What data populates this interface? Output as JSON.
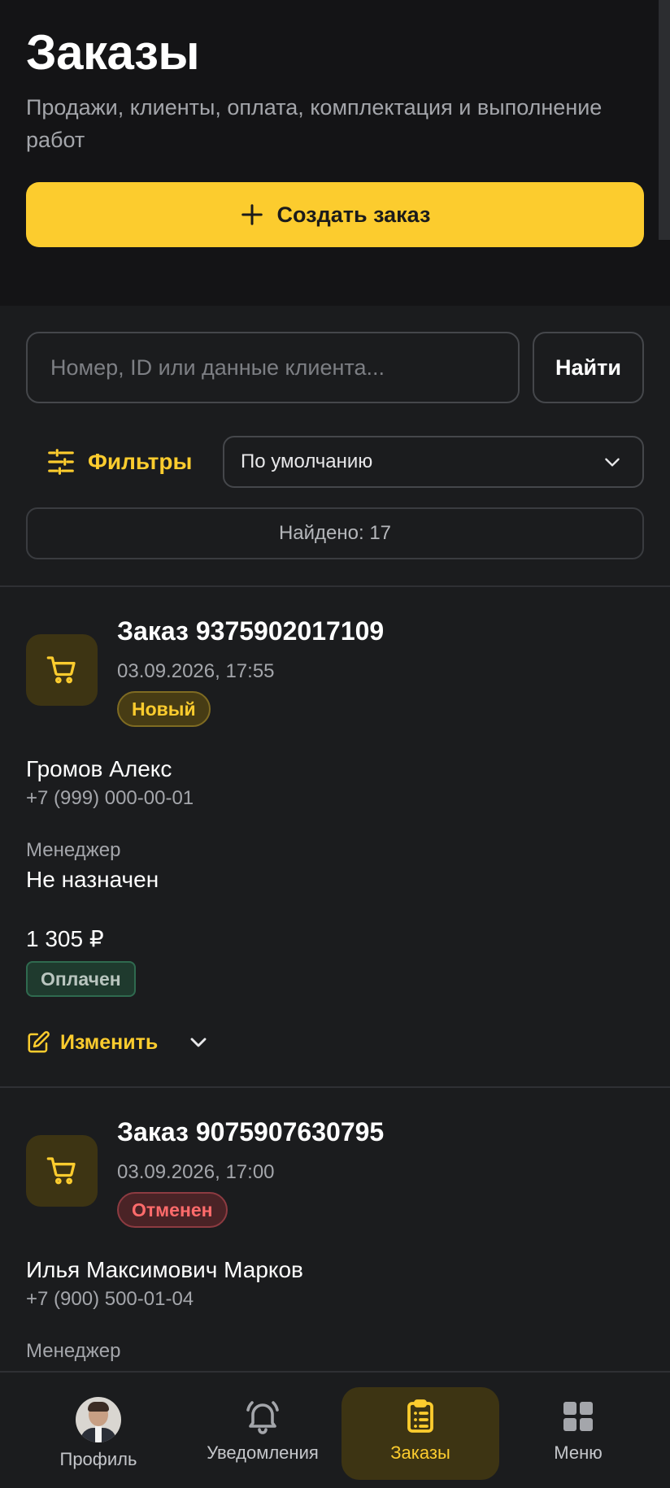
{
  "header": {
    "title": "Заказы",
    "subtitle": "Продажи, клиенты, оплата, комплектация и выполнение работ",
    "create_button": "Создать заказ"
  },
  "search": {
    "placeholder": "Номер, ID или данные клиента...",
    "value": "",
    "button": "Найти"
  },
  "filters": {
    "label": "Фильтры",
    "sort_selected": "По умолчанию",
    "found": "Найдено: 17"
  },
  "orders": [
    {
      "title": "Заказ 9375902017109",
      "date": "03.09.2026, 17:55",
      "status": "Новый",
      "client_name": "Громов Алекс",
      "client_phone": "+7 (999) 000-00-01",
      "manager_label": "Менеджер",
      "manager": "Не назначен",
      "sum": "1 305 ₽",
      "payment": "Оплачен",
      "edit": "Изменить"
    },
    {
      "title": "Заказ 9075907630795",
      "date": "03.09.2026, 17:00",
      "status": "Отменен",
      "client_name": "Илья Максимович Марков",
      "client_phone": "+7 (900) 500-01-04",
      "manager_label": "Менеджер"
    }
  ],
  "nav": {
    "profile": "Профиль",
    "notifications": "Уведомления",
    "orders": "Заказы",
    "menu": "Меню",
    "active": "orders"
  },
  "colors": {
    "accent": "#fccc2e",
    "background": "#1b1c1e",
    "header_bg": "#141416",
    "status_new": "#fccc2e",
    "status_cancelled": "#ff6b6b",
    "paid": "#2f6a4f"
  }
}
